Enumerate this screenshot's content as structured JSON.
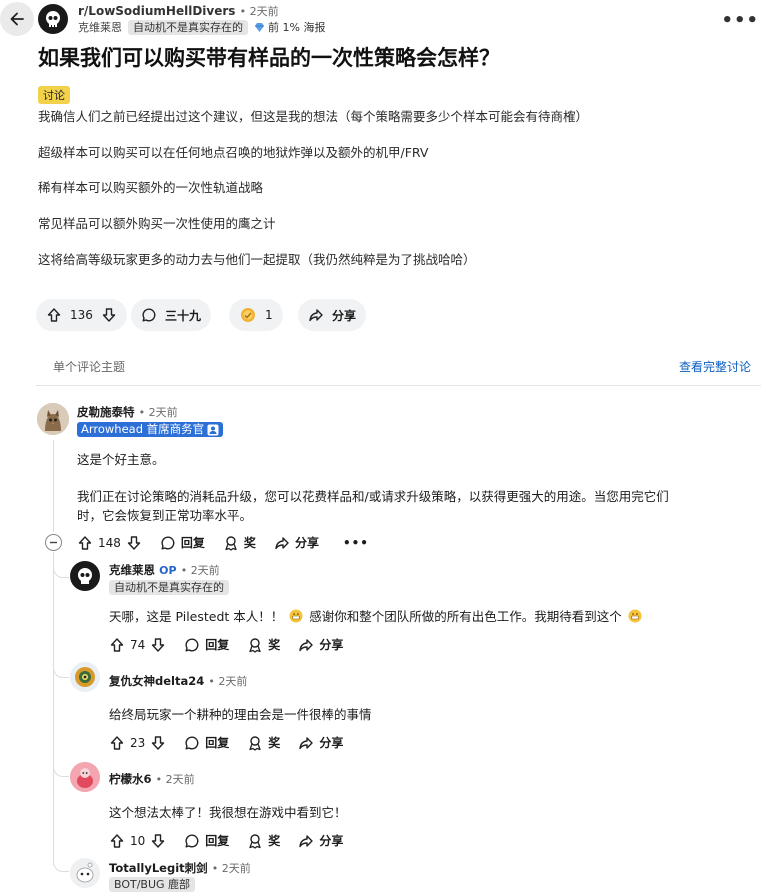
{
  "header": {
    "subreddit": "r/LowSodiumHellDivers",
    "time": "• 2天前",
    "author": "克维莱恩",
    "author_flair": "自动机不是真实存在的",
    "rank_flair": "前 1% 海报",
    "more": "•••"
  },
  "post": {
    "title": "如果我们可以购买带有样品的一次性策略会怎样？",
    "tag": "讨论",
    "paragraphs": [
      "我确信人们之前已经提出过这个建议，但这是我的想法（每个策略需要多少个样本可能会有待商榷）",
      "超级样本可以购买可以在任何地点召唤的地狱炸弹以及额外的机甲/FRV",
      "稀有样本可以购买额外的一次性轨道战略",
      "常见样品可以额外购买一次性使用的鹰之计",
      "这将给高等级玩家更多的动力去与他们一起提取（我仍然纯粹是为了挑战哈哈）"
    ],
    "votes": "136",
    "comments": "三十九",
    "awards": "1",
    "share": "分享"
  },
  "thread": {
    "label": "单个评论主题",
    "full_link": "查看完整讨论"
  },
  "comments": [
    {
      "author": "皮勒施泰特",
      "time": "• 2天前",
      "flair": "Arrowhead 首席商务官",
      "lines": [
        "这是个好主意。",
        "我们正在讨论策略的消耗品升级，您可以花费样品和/或请求升级策略，以获得更强大的用途。当您用完它们",
        "时，它会恢复到正常功率水平。"
      ],
      "votes": "148",
      "reply": "回复",
      "award": "奖",
      "share": "分享",
      "more": "•••"
    },
    {
      "author": "克维莱恩",
      "op": "OP",
      "time": "• 2天前",
      "flair": "自动机不是真实存在的",
      "text_a": "天哪，这是 Pilestedt 本人！！",
      "text_b": "感谢你和整个团队所做的所有出色工作。我期待看到这个",
      "votes": "74",
      "reply": "回复",
      "award": "奖",
      "share": "分享"
    },
    {
      "author": "复仇女神delta24",
      "time": "• 2天前",
      "text": "给终局玩家一个耕种的理由会是一件很棒的事情",
      "votes": "23",
      "reply": "回复",
      "award": "奖",
      "share": "分享"
    },
    {
      "author": "柠檬水6",
      "time": "• 2天前",
      "text": "这个想法太棒了！我很想在游戏中看到它！",
      "votes": "10",
      "reply": "回复",
      "award": "奖",
      "share": "分享"
    },
    {
      "author": "TotallyLegit刺剑",
      "time": "• 2天前",
      "flair": "BOT/BUG 鹿部"
    }
  ]
}
